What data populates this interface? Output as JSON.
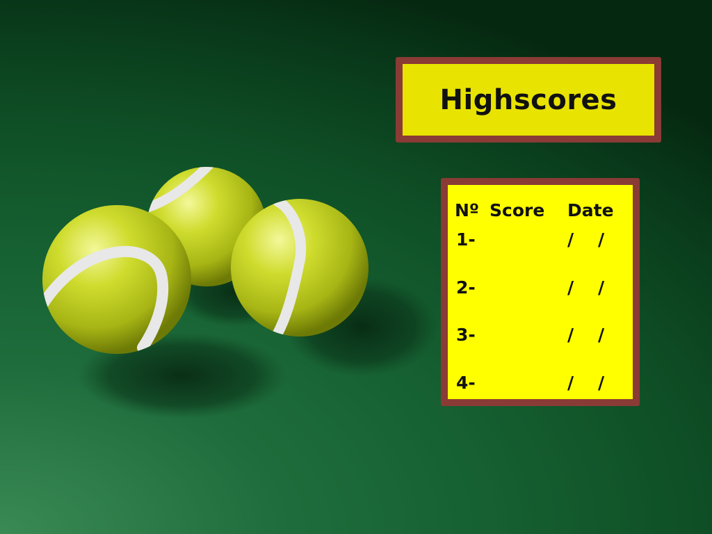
{
  "title": "Highscores",
  "table": {
    "headers": {
      "no": "Nº",
      "score": "Score",
      "date": "Date"
    },
    "rows": [
      {
        "rank": "1-",
        "score": "",
        "date": "/    /"
      },
      {
        "rank": "2-",
        "score": "",
        "date": "/    /"
      },
      {
        "rank": "3-",
        "score": "",
        "date": "/    /"
      },
      {
        "rank": "4-",
        "score": "",
        "date": "/    /"
      }
    ]
  },
  "colors": {
    "panel_fill": "#ffff00",
    "title_fill": "#e8e300",
    "border": "#8a3b35",
    "background": "#166132",
    "ball": "#c9d82a",
    "seam": "#e4e4e4"
  }
}
